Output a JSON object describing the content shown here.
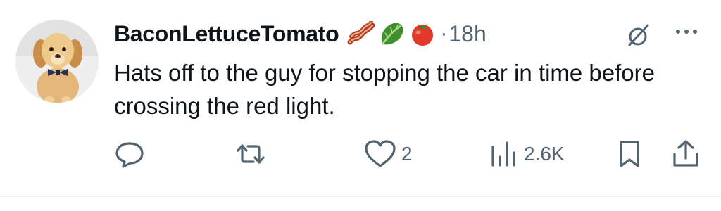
{
  "tweet": {
    "username": "BaconLettuceTomato",
    "name_emojis": [
      "bacon-icon",
      "lettuce-icon",
      "tomato-icon"
    ],
    "separator": "·",
    "time": "18h",
    "text": "Hats off to the guy for stopping the car in time before crossing the red light."
  },
  "actions": {
    "reply_count": "",
    "retweet_count": "",
    "like_count": "2",
    "views_count": "2.6K"
  },
  "colors": {
    "text": "#0f1419",
    "muted": "#536471",
    "divider": "#eff3f4"
  }
}
